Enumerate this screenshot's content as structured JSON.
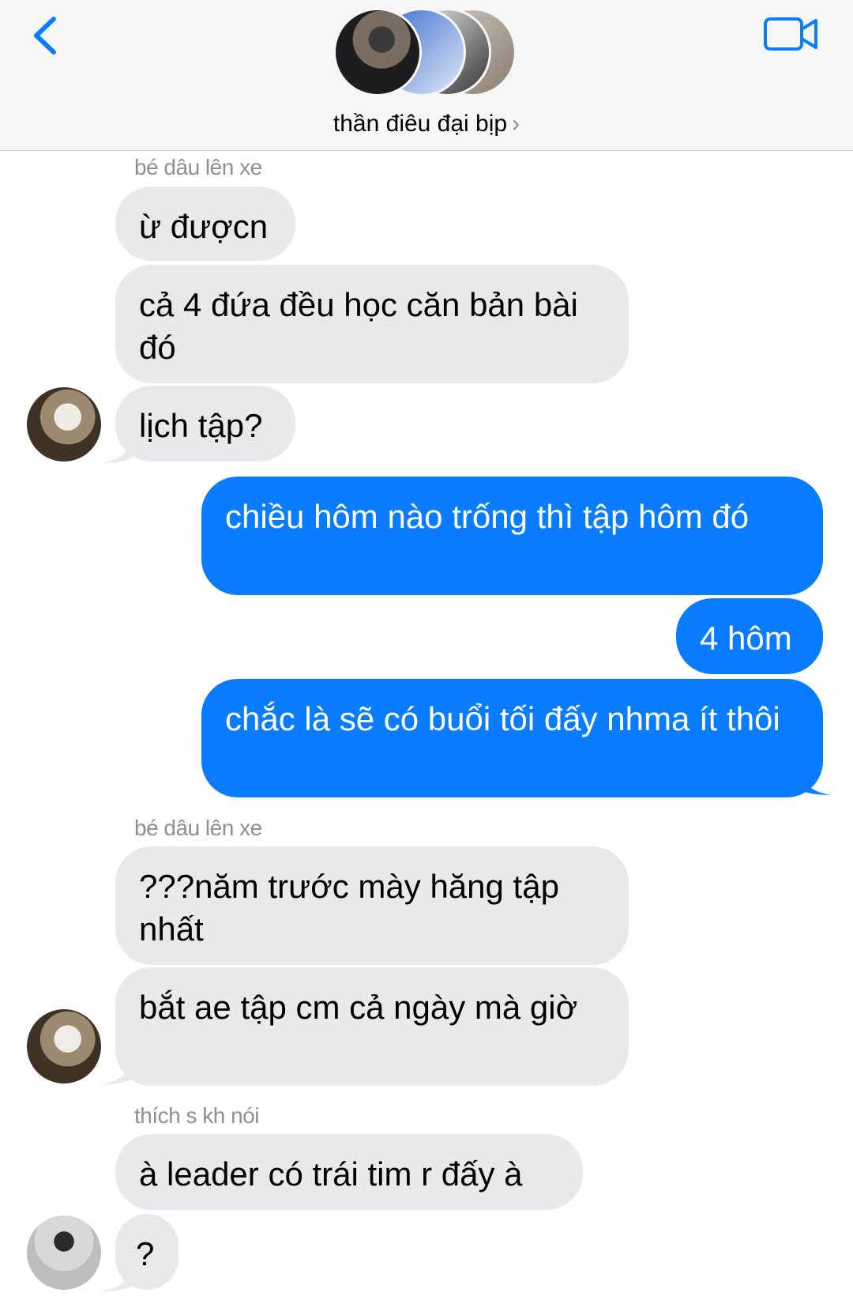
{
  "header": {
    "group_name": "thần điêu đại bịp",
    "chevron": "›",
    "back_icon": "chevron-left-icon",
    "video_icon": "video-camera-icon",
    "accent_color": "#0a7cff"
  },
  "messages": [
    {
      "sender": "bé dâu lên xe",
      "text": "ừ đượcn"
    },
    {
      "text": "cả 4 đứa đều học căn bản bài đó"
    },
    {
      "text": "lịch tập?"
    },
    {
      "text": "chiều hôm nào trống thì tập hôm đó"
    },
    {
      "text": "4 hôm"
    },
    {
      "text": "chắc là sẽ có buổi tối đấy nhma ít thôi"
    },
    {
      "sender": "bé dâu lên xe",
      "text": "???năm trước mày hăng tập nhất"
    },
    {
      "text": "bắt ae tập cm cả ngày mà giờ"
    },
    {
      "sender": "thích s kh nói",
      "text": "à leader có trái tim r đấy à"
    },
    {
      "text": "?"
    }
  ],
  "colors": {
    "incoming_bubble": "#e9e9eb",
    "outgoing_bubble": "#0a7cff",
    "sender_name": "#8e8e93"
  }
}
